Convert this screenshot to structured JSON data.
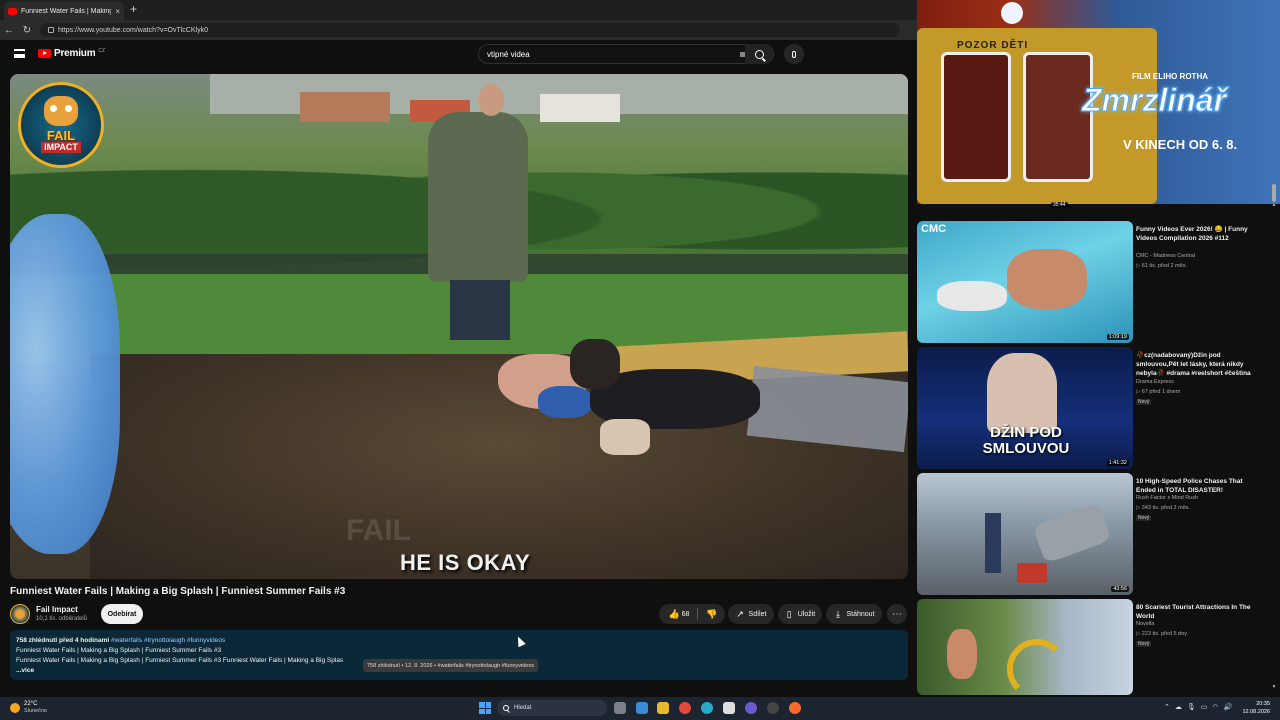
{
  "browser": {
    "tab_title": "Funniest Water Fails | Making",
    "tab_close": "×",
    "new_tab": "+",
    "url": "https://www.youtube.com/watch?v=OvTlcCKlyk0"
  },
  "header": {
    "logo_text": "Premium",
    "logo_region": "CZ",
    "search_value": "vtipné videa"
  },
  "video": {
    "badge_line1": "FAIL",
    "badge_line2": "IMPACT",
    "caption": "HE IS OKAY",
    "watermark": "FAIL",
    "title": "Funniest Water Fails | Making a Big Splash | Funniest Summer Fails #3"
  },
  "channel": {
    "name": "Fail Impact",
    "subscribers": "10,1 tis. odběratelů",
    "subscribe_label": "Odebírat"
  },
  "actions": {
    "likes": "68",
    "share": "Sdílet",
    "save": "Uložit",
    "download": "Stáhnout",
    "more": "⋯"
  },
  "description": {
    "meta": "758 zhlédnutí  před 4 hodinami",
    "tags": "#waterfails #trynottolaugh #funnyvideos",
    "line2": "Funniest Water Fails | Making a Big Splash | Funniest Summer Fails #3",
    "line3": "Funniest Water Fails | Making a Big Splash | Funniest Summer Fails #3 Funniest Water Fails | Making a Big Splas",
    "more": "...více",
    "tooltip": "758 zhlédnutí • 12. 8. 2026 • #waterfails #trynottolaugh #funnyvideos"
  },
  "ad": {
    "pozor": "POZOR DĚTI",
    "film": "FILM ELIHO ROTHA",
    "title": "Zmrzlinář",
    "date": "V KINECH OD 6. 8.",
    "duration": "35:44"
  },
  "recommendations": [
    {
      "title": "Funny Videos Ever 2026! 😂 | Funny Videos Compilation 2026 #112",
      "channel": "CMC - Madness Central",
      "stats": "▷ 61 tis.  před 2 měs.",
      "duration": "1:09:19",
      "thumb_label": "CMC",
      "new": ""
    },
    {
      "title": "🥀cz(nadabovaný)Džin pod smlouvou,Pět let lásky, která nikdy nebyla🥀 #drama #reelshort #čeština",
      "channel": "Drama Express",
      "stats": "▷ 67  před 1 dnem",
      "duration": "1:41:32",
      "thumb_label": "DŽIN POD SMLOUVOU",
      "new": "Nový"
    },
    {
      "title": "10 High-Speed Police Chases That Ended in TOTAL DISASTER!",
      "channel": "Rush Factor x Mind Rush",
      "stats": "▷ 343 tis.  před 2 měs.",
      "duration": "43:56",
      "thumb_label": "",
      "new": "Nový"
    },
    {
      "title": "80 Scariest Tourist Attractions In The World",
      "channel": "Novella",
      "stats": "▷ 223 tis.  před 5 dny",
      "duration": "",
      "thumb_label": "",
      "new": "Nový"
    }
  ],
  "taskbar": {
    "temp": "22°C",
    "weather": "Slunečno",
    "search": "Hledat",
    "time": "20:35",
    "date": "12.08.2026"
  },
  "colors": {
    "brand_red": "#ff0000",
    "background": "#0f0f0f",
    "description_bg": "#0a2838"
  }
}
